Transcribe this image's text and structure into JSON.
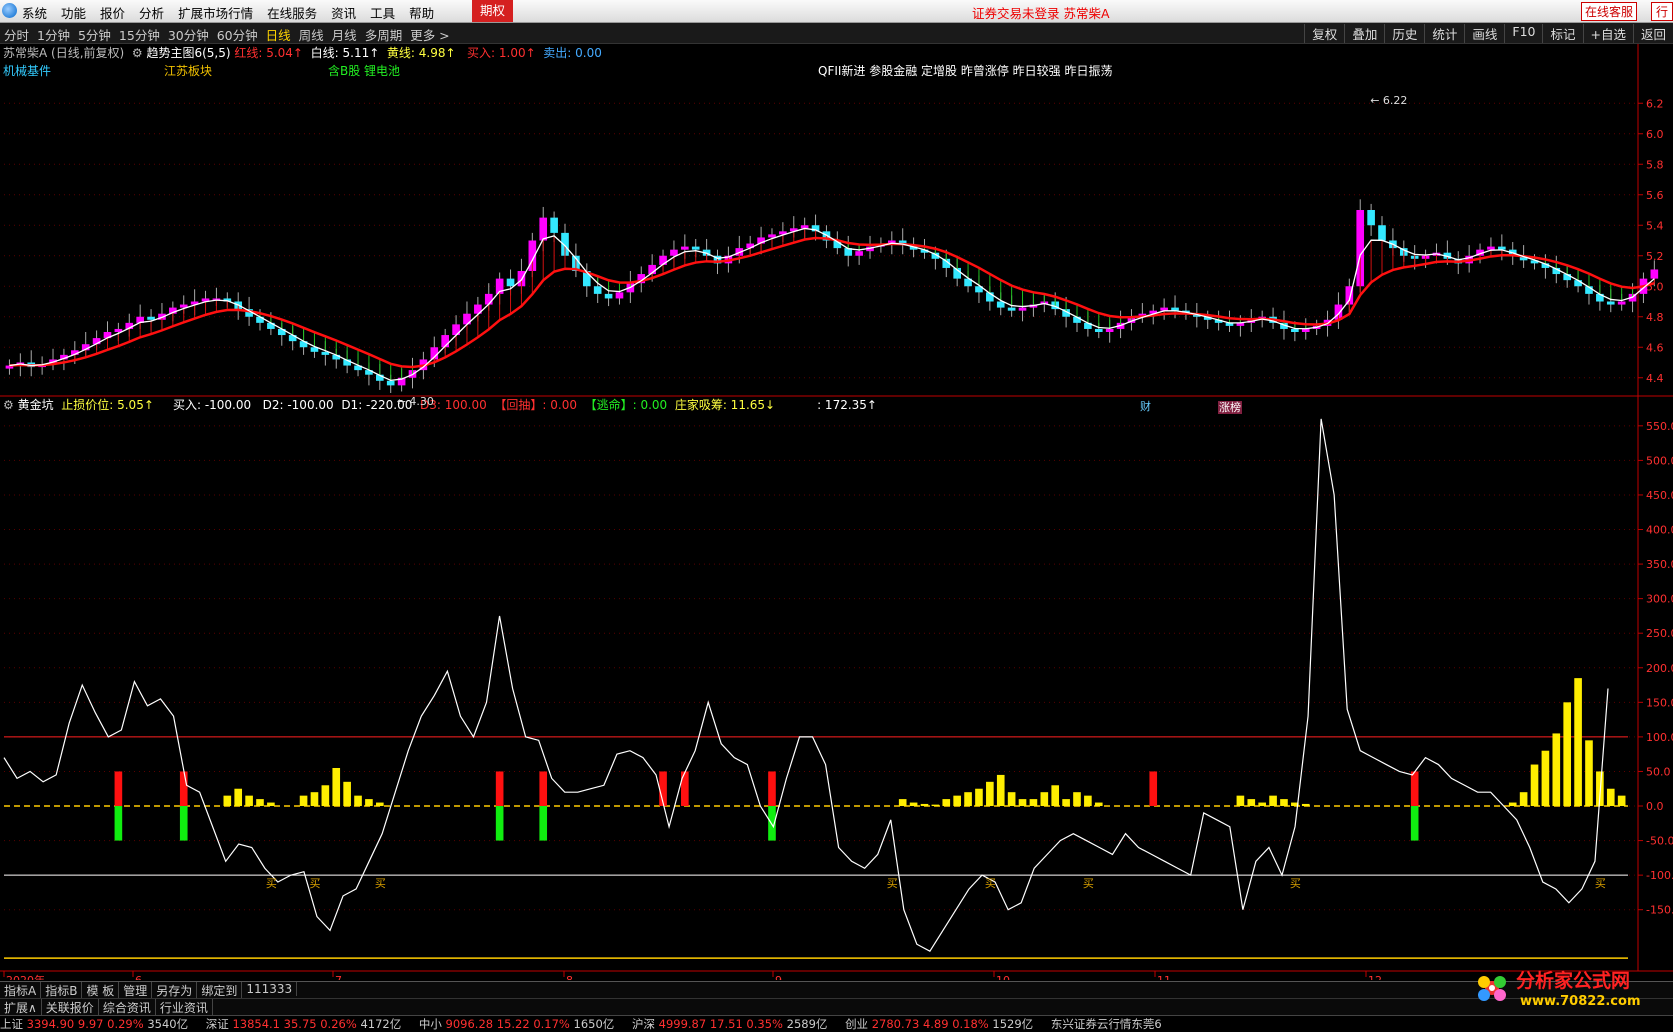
{
  "menubar": {
    "items": [
      "系统",
      "功能",
      "报价",
      "分析",
      "扩展市场行情",
      "在线服务",
      "资讯",
      "工具",
      "帮助"
    ],
    "options_label": "期权",
    "status": "证券交易未登录  苏常柴A",
    "service": "在线客服",
    "trade": "行"
  },
  "periodbar": {
    "items": [
      "分时",
      "1分钟",
      "5分钟",
      "15分钟",
      "30分钟",
      "60分钟",
      "日线",
      "周线",
      "月线",
      "多周期",
      "更多 >"
    ],
    "active": "日线",
    "right_items": [
      "复权",
      "叠加",
      "历史",
      "统计",
      "画线",
      "F10",
      "标记",
      "+自选",
      "返回"
    ]
  },
  "price_header": {
    "stock": "苏常柴A (日线,前复权)",
    "indicator": "趋势主图6(5,5)",
    "red_line": "红线: 5.04↑",
    "white_line": "白线: 5.11↑",
    "yellow_line": "黄线: 4.98↑",
    "buy": "买入: 1.00↑",
    "sell": "卖出: 0.00"
  },
  "tags": {
    "sector1": "机械基件",
    "sector2": "江苏板块",
    "sector3": "含B股 锂电池",
    "concepts": "QFII新进 参股金融 定增股 昨曾涨停 昨日较强 昨日振荡"
  },
  "price_annotations": {
    "high": "6.22",
    "low": "4.30",
    "cai": "财",
    "zhangbang": "涨榜"
  },
  "sub_header": {
    "name": "黄金坑",
    "stop": "止损价位: 5.05↑",
    "buy": "买入: -100.00",
    "d2": "D2: -100.00",
    "d1": "D1: -220.00",
    "d3": "D3: 100.00",
    "pullback": "【回抽】: 0.00",
    "escape": "【逃命】: 0.00",
    "zhuang": "庄家吸筹: 11.65↓",
    "last": ": 172.35↑"
  },
  "x_axis": {
    "labels": [
      "2020年",
      "6",
      "7",
      "8",
      "9",
      "10",
      "11",
      "12"
    ]
  },
  "bottom_tabs1": [
    "指标A",
    "指标B",
    "模 板",
    "管理",
    "另存为",
    "绑定到",
    "111333"
  ],
  "bottom_tabs2": [
    "扩展∧",
    "关联报价",
    "综合资讯",
    "行业资讯"
  ],
  "ticker": {
    "items": [
      {
        "name": "上证",
        "value": "3394.90",
        "chg": "9.97",
        "pct": "0.29%",
        "amt": "3540亿"
      },
      {
        "name": "深证",
        "value": "13854.1",
        "chg": "35.75",
        "pct": "0.26%",
        "amt": "4172亿"
      },
      {
        "name": "中小",
        "value": "9096.28",
        "chg": "15.22",
        "pct": "0.17%",
        "amt": "1650亿"
      },
      {
        "name": "沪深",
        "value": "4999.87",
        "chg": "17.51",
        "pct": "0.35%",
        "amt": "2589亿"
      },
      {
        "name": "创业",
        "value": "2780.73",
        "chg": "4.89",
        "pct": "0.18%",
        "amt": "1529亿"
      }
    ],
    "news": "东兴证券云行情东莞6"
  },
  "watermark": {
    "text": "分析家公式网",
    "url": "www.70822.com"
  },
  "colors": {
    "up": "#ff00ff",
    "down": "#33e8ff",
    "red_line": "#ff1010",
    "white_line": "#ffffff",
    "border": "#c00000"
  },
  "chart_data": [
    {
      "type": "candlestick",
      "title": "苏常柴A (日线,前复权)",
      "y_ticks": [
        4.4,
        4.6,
        4.8,
        5.0,
        5.2,
        5.4,
        5.6,
        5.8,
        6.0,
        6.2
      ],
      "ylim": [
        4.3,
        6.3
      ],
      "n_bars": 150,
      "annotated_high": 6.22,
      "annotated_low": 4.3,
      "close": [
        4.48,
        4.5,
        4.47,
        4.49,
        4.52,
        4.55,
        4.58,
        4.62,
        4.66,
        4.7,
        4.72,
        4.76,
        4.8,
        4.78,
        4.82,
        4.86,
        4.88,
        4.9,
        4.92,
        4.92,
        4.9,
        4.85,
        4.8,
        4.76,
        4.72,
        4.68,
        4.64,
        4.6,
        4.57,
        4.55,
        4.52,
        4.48,
        4.45,
        4.42,
        4.38,
        4.35,
        4.4,
        4.45,
        4.52,
        4.6,
        4.68,
        4.75,
        4.82,
        4.88,
        4.95,
        5.05,
        5.0,
        5.1,
        5.3,
        5.45,
        5.35,
        5.2,
        5.1,
        5.0,
        4.95,
        4.92,
        4.96,
        5.02,
        5.08,
        5.14,
        5.2,
        5.24,
        5.26,
        5.24,
        5.2,
        5.15,
        5.2,
        5.25,
        5.28,
        5.32,
        5.34,
        5.36,
        5.38,
        5.4,
        5.36,
        5.3,
        5.25,
        5.2,
        5.23,
        5.26,
        5.28,
        5.3,
        5.27,
        5.24,
        5.22,
        5.18,
        5.12,
        5.05,
        5.0,
        4.96,
        4.9,
        4.86,
        4.84,
        4.86,
        4.88,
        4.9,
        4.85,
        4.8,
        4.76,
        4.72,
        4.7,
        4.72,
        4.76,
        4.8,
        4.82,
        4.84,
        4.86,
        4.84,
        4.82,
        4.8,
        4.78,
        4.76,
        4.74,
        4.76,
        4.78,
        4.8,
        4.76,
        4.72,
        4.7,
        4.72,
        4.74,
        4.78,
        4.88,
        5.0,
        5.5,
        5.4,
        5.3,
        5.25,
        5.2,
        5.18,
        5.2,
        5.22,
        5.18,
        5.15,
        5.2,
        5.24,
        5.26,
        5.24,
        5.2,
        5.17,
        5.15,
        5.12,
        5.08,
        5.04,
        5.0,
        4.95,
        4.9,
        4.88,
        4.9,
        4.95,
        5.05,
        5.11
      ],
      "red_line_end": 5.04,
      "white_line_end": 5.11,
      "yellow_line_end": 4.98
    },
    {
      "type": "line+bar",
      "title": "黄金坑",
      "y_ticks": [
        -150,
        -100,
        -50,
        0,
        50,
        100,
        150,
        200,
        250,
        300,
        350,
        400,
        450,
        500,
        550
      ],
      "ylim": [
        -230,
        570
      ],
      "reference_lines": [
        100,
        0,
        -100,
        -220
      ],
      "line": [
        70,
        40,
        50,
        35,
        45,
        120,
        175,
        135,
        100,
        110,
        180,
        145,
        155,
        130,
        30,
        20,
        -30,
        -80,
        -55,
        -60,
        -90,
        -110,
        -100,
        -95,
        -160,
        -180,
        -130,
        -120,
        -80,
        -40,
        20,
        80,
        130,
        160,
        195,
        130,
        100,
        150,
        275,
        170,
        100,
        95,
        40,
        20,
        20,
        25,
        30,
        75,
        80,
        70,
        45,
        -30,
        40,
        80,
        150,
        90,
        70,
        60,
        0,
        -30,
        40,
        100,
        100,
        60,
        -60,
        -80,
        -90,
        -70,
        -20,
        -150,
        -200,
        -210,
        -180,
        -150,
        -120,
        -100,
        -110,
        -150,
        -140,
        -90,
        -70,
        -50,
        -40,
        -50,
        -60,
        -70,
        -40,
        -60,
        -70,
        -80,
        -90,
        -100,
        -10,
        -20,
        -30,
        -150,
        -80,
        -60,
        -100,
        -30,
        130,
        560,
        450,
        140,
        80,
        70,
        60,
        50,
        45,
        70,
        60,
        40,
        30,
        20,
        20,
        0,
        -20,
        -60,
        -110,
        -120,
        -140,
        -120,
        -80,
        170
      ],
      "yellow_bars": [
        0,
        0,
        0,
        0,
        0,
        0,
        0,
        0,
        0,
        0,
        0,
        0,
        0,
        0,
        0,
        0,
        0,
        0,
        0,
        0,
        15,
        25,
        15,
        10,
        5,
        0,
        0,
        15,
        20,
        30,
        55,
        35,
        15,
        10,
        5,
        0,
        0,
        0,
        0,
        0,
        0,
        0,
        0,
        0,
        0,
        0,
        0,
        0,
        0,
        0,
        0,
        0,
        0,
        0,
        0,
        0,
        0,
        0,
        0,
        0,
        0,
        0,
        0,
        0,
        0,
        0,
        0,
        0,
        0,
        0,
        0,
        0,
        0,
        0,
        0,
        0,
        0,
        0,
        0,
        0,
        0,
        0,
        10,
        5,
        3,
        2,
        10,
        15,
        20,
        25,
        35,
        45,
        20,
        10,
        10,
        20,
        30,
        10,
        20,
        15,
        5,
        0,
        0,
        0,
        0,
        0,
        0,
        0,
        0,
        0,
        0,
        0,
        0,
        15,
        10,
        5,
        15,
        10,
        5,
        3,
        0,
        0,
        0,
        0,
        0,
        0,
        0,
        0,
        0,
        0,
        0,
        0,
        0,
        0,
        0,
        0,
        0,
        0,
        5,
        20,
        60,
        80,
        105,
        150,
        185,
        95,
        50,
        25,
        15
      ],
      "buy_signal_bars": [
        10,
        16,
        45,
        49,
        70,
        129
      ],
      "extra_red_bars": [
        60,
        62,
        105
      ],
      "buy_labels_at": [
        24,
        28,
        34,
        81,
        90,
        99,
        118,
        146
      ],
      "buy_label": "买"
    }
  ]
}
